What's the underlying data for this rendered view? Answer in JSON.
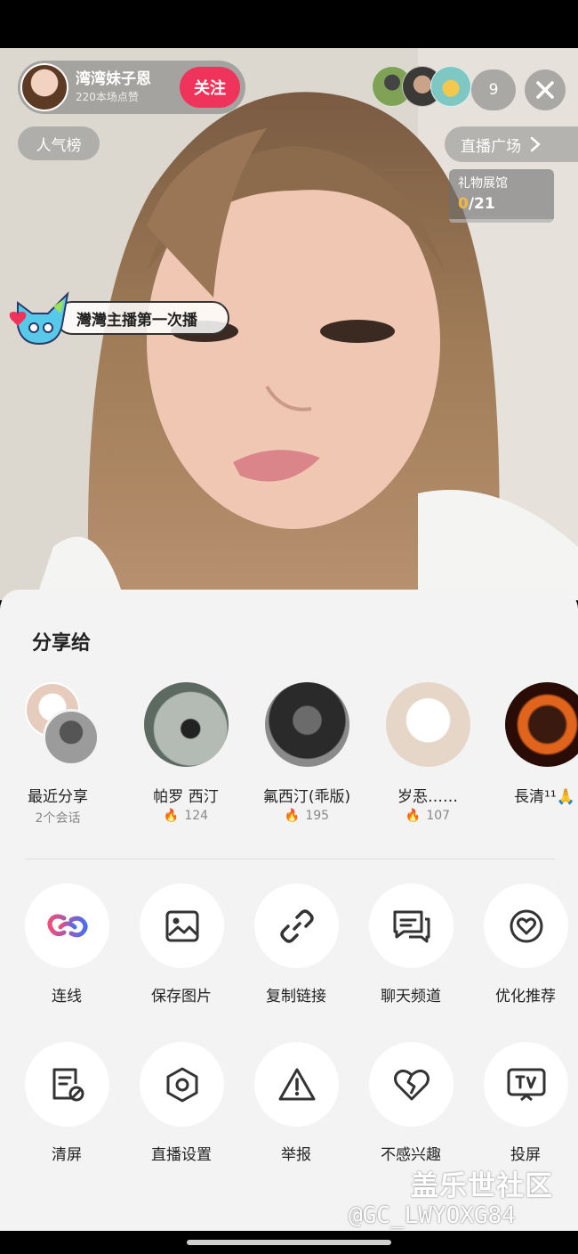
{
  "stream": {
    "host_name": "湾湾妹子恩",
    "host_likes": "220本场点赞",
    "follow_label": "关注",
    "viewer_count": "9",
    "rank_label": "人气榜",
    "plaza_label": "直播广场",
    "gift": {
      "title": "礼物展馆",
      "current": "0",
      "total": "/21"
    },
    "banner_text": "灣灣主播第一次播"
  },
  "share": {
    "title": "分享给",
    "contacts": [
      {
        "name": "最近分享",
        "sub": "2个会话"
      },
      {
        "name": "帕罗 西汀",
        "sub": "124"
      },
      {
        "name": "氟西汀(乖版)",
        "sub": "195"
      },
      {
        "name": "岁忢……",
        "sub": "107"
      },
      {
        "name": "長清¹¹🙏",
        "sub": ""
      }
    ],
    "actions_row1": [
      {
        "label": "连线",
        "icon": "link-loop-icon"
      },
      {
        "label": "保存图片",
        "icon": "image-icon"
      },
      {
        "label": "复制链接",
        "icon": "chain-link-icon"
      },
      {
        "label": "聊天频道",
        "icon": "chat-bubbles-icon"
      },
      {
        "label": "优化推荐",
        "icon": "heart-circle-icon"
      }
    ],
    "actions_row2": [
      {
        "label": "清屏",
        "icon": "clear-screen-icon"
      },
      {
        "label": "直播设置",
        "icon": "hexagon-settings-icon"
      },
      {
        "label": "举报",
        "icon": "warning-icon"
      },
      {
        "label": "不感兴趣",
        "icon": "broken-heart-icon"
      },
      {
        "label": "投屏",
        "icon": "tv-cast-icon"
      }
    ]
  },
  "watermark": {
    "line1": "盖乐世社区",
    "line2": "@GC_LWYOXG84"
  },
  "colors": {
    "follow": "#f0335a",
    "gift_current": "#f5b73b",
    "sheet_bg": "#f3f3f3"
  }
}
